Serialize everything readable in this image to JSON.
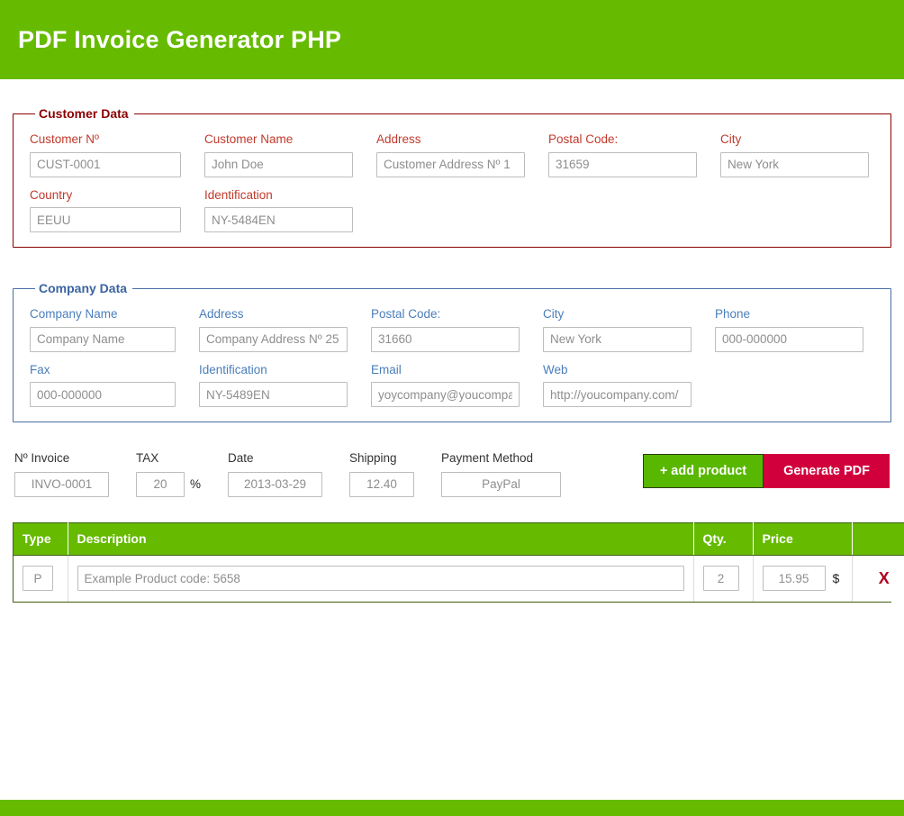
{
  "header": {
    "title": "PDF Invoice Generator PHP"
  },
  "customer": {
    "legend": "Customer Data",
    "fields": [
      {
        "label": "Customer Nº",
        "placeholder": "CUST-0001",
        "value": ""
      },
      {
        "label": "Customer Name",
        "placeholder": "John Doe",
        "value": ""
      },
      {
        "label": "Address",
        "placeholder": "Customer Address Nº 1",
        "value": ""
      },
      {
        "label": "Postal Code:",
        "placeholder": "31659",
        "value": ""
      },
      {
        "label": "City",
        "placeholder": "New York",
        "value": ""
      },
      {
        "label": "Country",
        "placeholder": "EEUU",
        "value": ""
      },
      {
        "label": "Identification",
        "placeholder": "NY-5484EN",
        "value": ""
      }
    ]
  },
  "company": {
    "legend": "Company Data",
    "fields": [
      {
        "label": "Company Name",
        "placeholder": "Company Name",
        "value": ""
      },
      {
        "label": "Address",
        "placeholder": "Company Address Nº 25",
        "value": ""
      },
      {
        "label": "Postal Code:",
        "placeholder": "31660",
        "value": ""
      },
      {
        "label": "City",
        "placeholder": "New York",
        "value": ""
      },
      {
        "label": "Phone",
        "placeholder": "000-000000",
        "value": ""
      },
      {
        "label": "Fax",
        "placeholder": "000-000000",
        "value": ""
      },
      {
        "label": "Identification",
        "placeholder": "NY-5489EN",
        "value": ""
      },
      {
        "label": "Email",
        "placeholder": "yoycompany@youcompany.com",
        "value": ""
      },
      {
        "label": "Web",
        "placeholder": "http://youcompany.com/",
        "value": ""
      }
    ]
  },
  "invoice_meta": {
    "fields": [
      {
        "label": "Nº Invoice",
        "placeholder": "INVO-0001",
        "value": "",
        "suffix": ""
      },
      {
        "label": "TAX",
        "placeholder": "20",
        "value": "",
        "suffix": "%"
      },
      {
        "label": "Date",
        "placeholder": "2013-03-29",
        "value": "",
        "suffix": ""
      },
      {
        "label": "Shipping",
        "placeholder": "12.40",
        "value": "",
        "suffix": ""
      },
      {
        "label": "Payment Method",
        "placeholder": "PayPal",
        "value": "",
        "suffix": ""
      }
    ],
    "add_product_label": "+ add product",
    "generate_pdf_label": "Generate PDF"
  },
  "products_table": {
    "columns": [
      "Type",
      "Description",
      "Qty.",
      "Price",
      ""
    ],
    "rows": [
      {
        "type_placeholder": "P",
        "type_value": "",
        "description_placeholder": "Example Product code: 5658",
        "description_value": "",
        "qty_placeholder": "2",
        "qty_value": "",
        "price_placeholder": "15.95",
        "price_value": "",
        "currency": "$",
        "delete_label": "X"
      }
    ]
  },
  "colors": {
    "brand_green": "#66bb00",
    "button_green": "#58b700",
    "crimson": "#d1003c",
    "customer_border": "#8b0000",
    "customer_label": "#c0392b",
    "company_border": "#4a6fa5",
    "company_label": "#4a7ebb",
    "delete_red": "#b00020"
  }
}
